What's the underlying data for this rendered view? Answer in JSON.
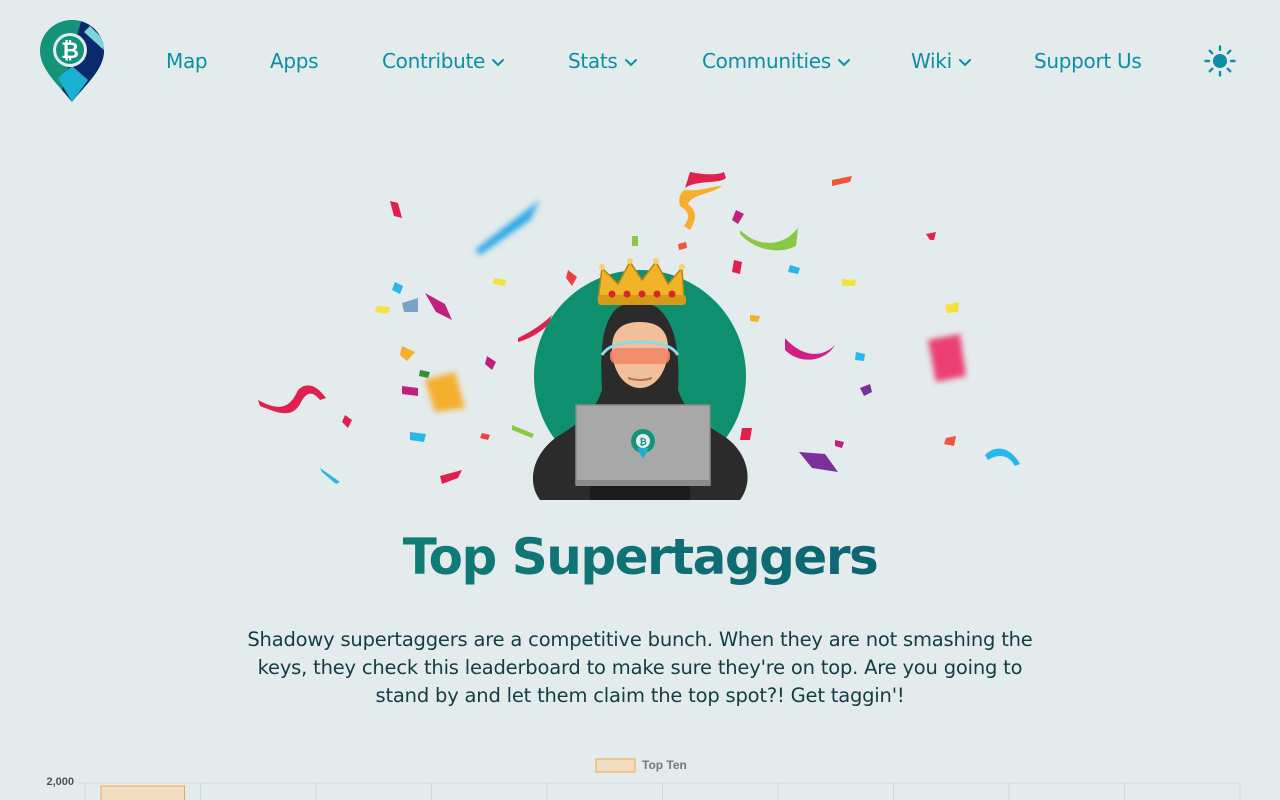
{
  "nav": {
    "items": [
      {
        "label": "Map",
        "dropdown": false
      },
      {
        "label": "Apps",
        "dropdown": false
      },
      {
        "label": "Contribute",
        "dropdown": true
      },
      {
        "label": "Stats",
        "dropdown": true
      },
      {
        "label": "Communities",
        "dropdown": true
      },
      {
        "label": "Wiki",
        "dropdown": true
      },
      {
        "label": "Support Us",
        "dropdown": false
      }
    ],
    "theme_icon": "sun-icon",
    "logo_icon": "btcmap-logo-icon"
  },
  "hero": {
    "title": "Top Supertaggers",
    "description": "Shadowy supertaggers are a competitive bunch. When they are not smashing the keys, they check this leaderboard to make sure they're on top. Are you going to stand by and let them claim the top spot?! Get taggin'!",
    "illustration_icon": "hooded-hacker-with-crown-icon"
  },
  "colors": {
    "accent": "#0c8fa6",
    "background": "#e3ebec",
    "title_gradient_start": "#12907a",
    "title_gradient_end": "#0c4f70",
    "bar_fill": "#f2ddc2",
    "bar_stroke": "#f0a84a"
  },
  "chart_data": {
    "type": "bar",
    "series": [
      {
        "name": "Top Ten",
        "values": [
          2000
        ]
      }
    ],
    "y_ticks": [
      "2,000"
    ],
    "legend_position": "top",
    "grid": true
  }
}
